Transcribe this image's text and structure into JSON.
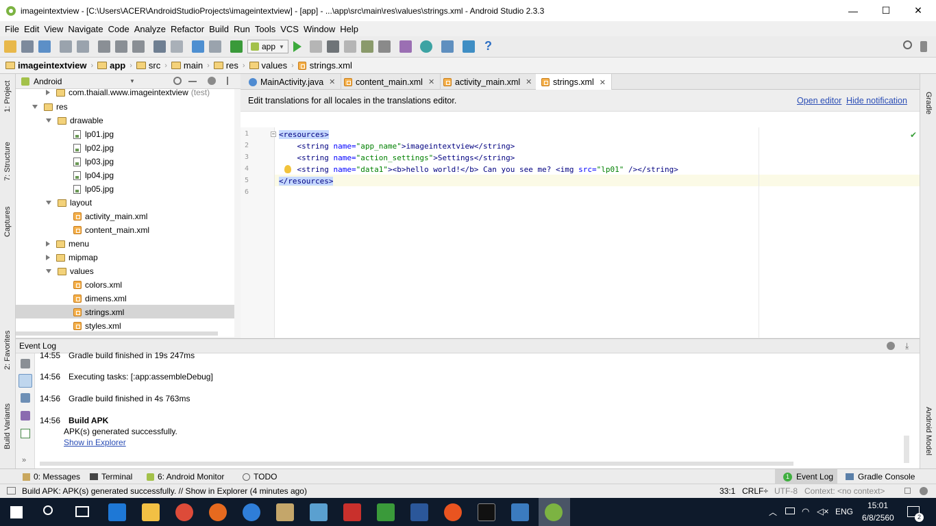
{
  "window": {
    "title": "imageintextview - [C:\\Users\\ACER\\AndroidStudioProjects\\imageintextview] - [app] - ...\\app\\src\\main\\res\\values\\strings.xml - Android Studio 2.3.3",
    "minimize": "—",
    "maximize": "☐",
    "close": "✕"
  },
  "menu": [
    "File",
    "Edit",
    "View",
    "Navigate",
    "Code",
    "Analyze",
    "Refactor",
    "Build",
    "Run",
    "Tools",
    "VCS",
    "Window",
    "Help"
  ],
  "toolbar": {
    "run_config": "app"
  },
  "breadcrumbs": [
    "imageintextview",
    "app",
    "src",
    "main",
    "res",
    "values",
    "strings.xml"
  ],
  "left_tools": [
    "1: Project",
    "7: Structure",
    "Captures",
    "2: Favorites",
    "Build Variants"
  ],
  "right_tools": [
    "Gradle",
    "Android Model"
  ],
  "project_panel": {
    "view_mode": "Android",
    "tree": [
      {
        "label": "com.thaiall.www.imageintextview",
        "suffix": "(test)",
        "type": "package",
        "level": 1,
        "expand": "right"
      },
      {
        "label": "res",
        "type": "folder",
        "level": 0,
        "expand": "down"
      },
      {
        "label": "drawable",
        "type": "folder",
        "level": 1,
        "expand": "down"
      },
      {
        "label": "lp01.jpg",
        "type": "image",
        "level": 2
      },
      {
        "label": "lp02.jpg",
        "type": "image",
        "level": 2
      },
      {
        "label": "lp03.jpg",
        "type": "image",
        "level": 2
      },
      {
        "label": "lp04.jpg",
        "type": "image",
        "level": 2
      },
      {
        "label": "lp05.jpg",
        "type": "image",
        "level": 2
      },
      {
        "label": "layout",
        "type": "folder",
        "level": 1,
        "expand": "down"
      },
      {
        "label": "activity_main.xml",
        "type": "xml",
        "level": 2
      },
      {
        "label": "content_main.xml",
        "type": "xml",
        "level": 2
      },
      {
        "label": "menu",
        "type": "folder",
        "level": 1,
        "expand": "right"
      },
      {
        "label": "mipmap",
        "type": "folder",
        "level": 1,
        "expand": "right"
      },
      {
        "label": "values",
        "type": "folder",
        "level": 1,
        "expand": "down"
      },
      {
        "label": "colors.xml",
        "type": "xml",
        "level": 2
      },
      {
        "label": "dimens.xml",
        "type": "xml",
        "level": 2
      },
      {
        "label": "strings.xml",
        "type": "xml",
        "level": 2,
        "selected": true
      },
      {
        "label": "styles.xml",
        "type": "xml",
        "level": 2
      }
    ]
  },
  "editor_tabs": [
    {
      "label": "MainActivity.java",
      "icon": "java-class-icon",
      "active": false
    },
    {
      "label": "content_main.xml",
      "icon": "xml-icon",
      "active": false
    },
    {
      "label": "activity_main.xml",
      "icon": "xml-icon",
      "active": false
    },
    {
      "label": "strings.xml",
      "icon": "xml-icon",
      "active": true
    }
  ],
  "notification": {
    "text": "Edit translations for all locales in the translations editor.",
    "open_editor": "Open editor",
    "hide": "Hide notification"
  },
  "code_lines": [
    {
      "n": "1",
      "parts": [
        {
          "t": "<resources>",
          "c": "tg hl"
        }
      ]
    },
    {
      "n": "2",
      "parts": [
        {
          "t": "    <string ",
          "c": "tg"
        },
        {
          "t": "name=",
          "c": "at"
        },
        {
          "t": "\"app_name\"",
          "c": "av"
        },
        {
          "t": ">imageintextview</string>",
          "c": "tg"
        }
      ]
    },
    {
      "n": "3",
      "parts": [
        {
          "t": "    <string ",
          "c": "tg"
        },
        {
          "t": "name=",
          "c": "at"
        },
        {
          "t": "\"action_settings\"",
          "c": "av"
        },
        {
          "t": ">Settings</string>",
          "c": "tg"
        }
      ]
    },
    {
      "n": "4",
      "parts": [
        {
          "t": "    <string ",
          "c": "tg"
        },
        {
          "t": "name=",
          "c": "at"
        },
        {
          "t": "\"data1\"",
          "c": "av"
        },
        {
          "t": "><b>hello world!</b> Can you see me? <img ",
          "c": "tg"
        },
        {
          "t": "src=",
          "c": "at"
        },
        {
          "t": "\"lp01\"",
          "c": "av"
        },
        {
          "t": " /></string>",
          "c": "tg"
        }
      ]
    },
    {
      "n": "5",
      "parts": [
        {
          "t": "</resources>",
          "c": "tg hl"
        }
      ]
    },
    {
      "n": "6",
      "parts": []
    }
  ],
  "event_log": {
    "title": "Event Log",
    "entries": [
      {
        "time": "14:55",
        "text": "Gradle build finished in 19s 247ms",
        "bold": false
      },
      {
        "time": "14:56",
        "text": "Executing tasks: [:app:assembleDebug]",
        "bold": false
      },
      {
        "time": "14:56",
        "text": "Gradle build finished in 4s 763ms",
        "bold": false
      },
      {
        "time": "14:56",
        "text": "Build APK",
        "bold": true,
        "detail": "APK(s) generated successfully.",
        "link": "Show in Explorer"
      }
    ]
  },
  "bottom_tabs": {
    "left": [
      {
        "label": "0: Messages",
        "icon": "messages-icon"
      },
      {
        "label": "Terminal",
        "icon": "terminal-icon"
      },
      {
        "label": "6: Android Monitor",
        "icon": "android-icon"
      },
      {
        "label": "TODO",
        "icon": "todo-icon"
      }
    ],
    "right": [
      {
        "label": "Event Log",
        "badge": "1",
        "active": true
      },
      {
        "label": "Gradle Console",
        "active": false
      }
    ]
  },
  "status": {
    "message": "Build APK: APK(s) generated successfully. // Show in Explorer (4 minutes ago)",
    "position": "33:1",
    "line_sep": "CRLF÷",
    "encoding": "UTF-8",
    "context": "Context: <no context>"
  },
  "taskbar": {
    "lang": "ENG",
    "time": "15:01",
    "date": "6/8/2560",
    "notif_count": "2"
  }
}
